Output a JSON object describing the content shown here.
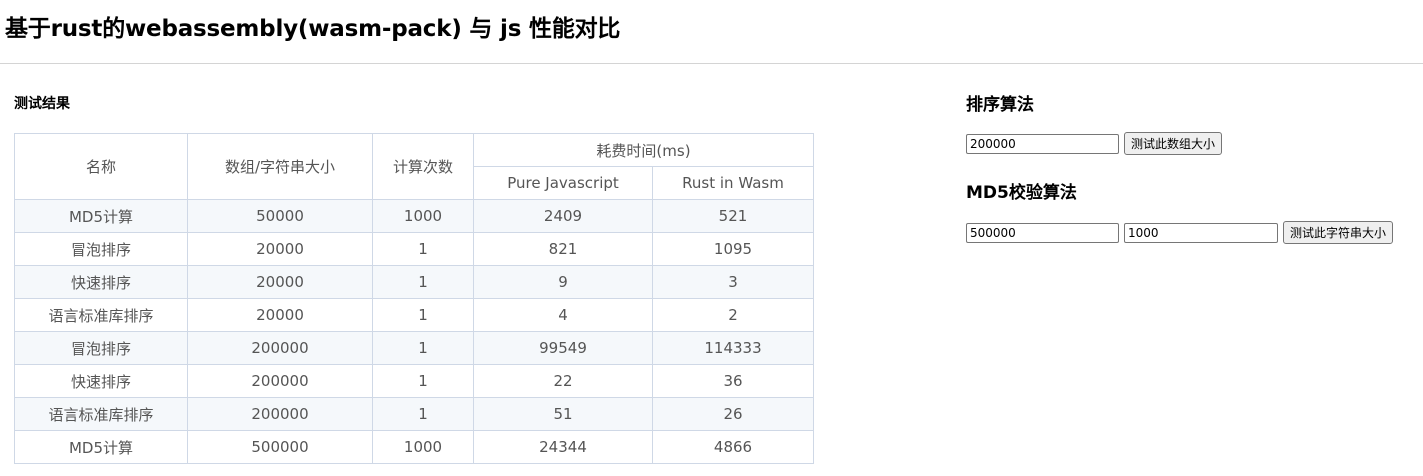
{
  "page": {
    "title": "基于rust的webassembly(wasm-pack) 与 js 性能对比"
  },
  "results": {
    "section_title": "测试结果",
    "headers": {
      "name": "名称",
      "size": "数组/字符串大小",
      "count": "计算次数",
      "time": "耗费时间(ms)",
      "js": "Pure Javascript",
      "wasm": "Rust in Wasm"
    },
    "rows": [
      [
        "MD5计算",
        "50000",
        "1000",
        "2409",
        "521"
      ],
      [
        "冒泡排序",
        "20000",
        "1",
        "821",
        "1095"
      ],
      [
        "快速排序",
        "20000",
        "1",
        "9",
        "3"
      ],
      [
        "语言标准库排序",
        "20000",
        "1",
        "4",
        "2"
      ],
      [
        "冒泡排序",
        "200000",
        "1",
        "99549",
        "114333"
      ],
      [
        "快速排序",
        "200000",
        "1",
        "22",
        "36"
      ],
      [
        "语言标准库排序",
        "200000",
        "1",
        "51",
        "26"
      ],
      [
        "MD5计算",
        "500000",
        "1000",
        "24344",
        "4866"
      ]
    ]
  },
  "sort_panel": {
    "title": "排序算法",
    "size_value": "200000",
    "button_label": "测试此数组大小"
  },
  "md5_panel": {
    "title": "MD5校验算法",
    "size_value": "500000",
    "count_value": "1000",
    "button_label": "测试此字符串大小"
  }
}
